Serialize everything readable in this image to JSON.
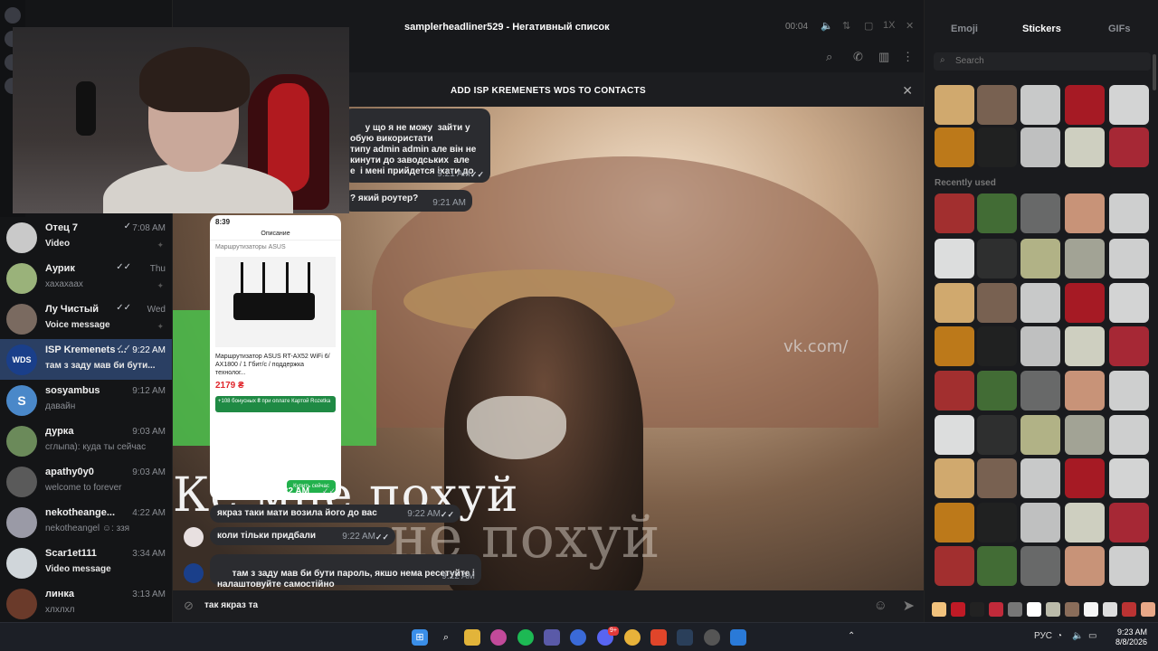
{
  "header": {
    "title": "samplerheadliner529 - Негативный список",
    "media_time": "00:04",
    "speed": "1X"
  },
  "chats": [
    {
      "name": "Отец 7",
      "time": "7:08 AM",
      "preview": "Video",
      "check": "✓",
      "avatar": ""
    },
    {
      "name": "Аурик",
      "time": "Thu",
      "preview": "хахахаах",
      "check": "✓✓",
      "avatar": ""
    },
    {
      "name": "Лу Чистый",
      "time": "Wed",
      "preview": "Voice message",
      "check": "✓✓",
      "avatar": ""
    },
    {
      "name": "ISP Kremenets ...",
      "time": "9:22 AM",
      "preview": "там з заду мав би бути...",
      "check": "✓✓",
      "avatar": "WDS"
    },
    {
      "name": "sosyambus",
      "time": "9:12 AM",
      "preview": "давайн",
      "check": "",
      "avatar": "S"
    },
    {
      "name": "дурка",
      "time": "9:03 AM",
      "preview": "сглыпа): куда ты сейчас",
      "check": "",
      "avatar": ""
    },
    {
      "name": "apathy0y0",
      "time": "9:03 AM",
      "preview": "welcome to forever",
      "check": "",
      "avatar": ""
    },
    {
      "name": "nekotheange...",
      "time": "4:22 AM",
      "preview": "nekotheangel ☺: ззя",
      "check": "",
      "avatar": ""
    },
    {
      "name": "Scar1et111",
      "time": "3:34 AM",
      "preview": "Video message",
      "check": "",
      "avatar": ""
    },
    {
      "name": "линка",
      "time": "3:13 AM",
      "preview": "хлхлхл",
      "check": "",
      "avatar": ""
    }
  ],
  "contact_banner": "ADD ISP KREMENETS WDS TO CONTACTS",
  "messages": [
    {
      "text": "у що я не можу  зайти у\nобую використати\nтипу admin admin але він не\nкинути до заводських  але\nе  і мені прийдется іхати до",
      "time": "9:21 AM",
      "check": "✓✓"
    },
    {
      "text": "? який роутер?",
      "time": "9:21 AM",
      "check": ""
    },
    {
      "text": "якраз таки мати возила  його до вас",
      "time": "9:22 AM",
      "check": "✓✓"
    },
    {
      "text": "коли тільки  придбали",
      "time": "9:22 AM",
      "check": "✓✓"
    },
    {
      "text": "там з заду мав би бути пароль, якшо нема ресетуйте і\nналаштовуйте самостійно",
      "time": "9:22 AM",
      "check": ""
    }
  ],
  "phone": {
    "clock": "8:39",
    "nav_title": "Описание",
    "category": "Маршрутизаторы ASUS",
    "product": "Маршрутизатор ASUS RT-AX52 WiFi 6/ AX1800 / 1 Гбит/с / поддержка технолог...",
    "price": "2179 ₴",
    "bonus": "+108 бонусных ₴ при оплате Картой Rozetka",
    "buy": "Купить сейчас",
    "time": "9:22 AM",
    "check": "✓✓"
  },
  "image_text": {
    "big": "Ке мне похуй",
    "ghost": "не похуй",
    "watermark": "vk.com/"
  },
  "composer": {
    "text": "так якраз та"
  },
  "panel": {
    "tabs": [
      "Emoji",
      "Stickers",
      "GIFs"
    ],
    "active_tab": "Stickers",
    "search_placeholder": "Search",
    "recently_used": "Recently used"
  },
  "taskbar": {
    "lang": "РУС",
    "time": "9:23 AM",
    "date": "8/8/2026",
    "badge": "9+"
  }
}
